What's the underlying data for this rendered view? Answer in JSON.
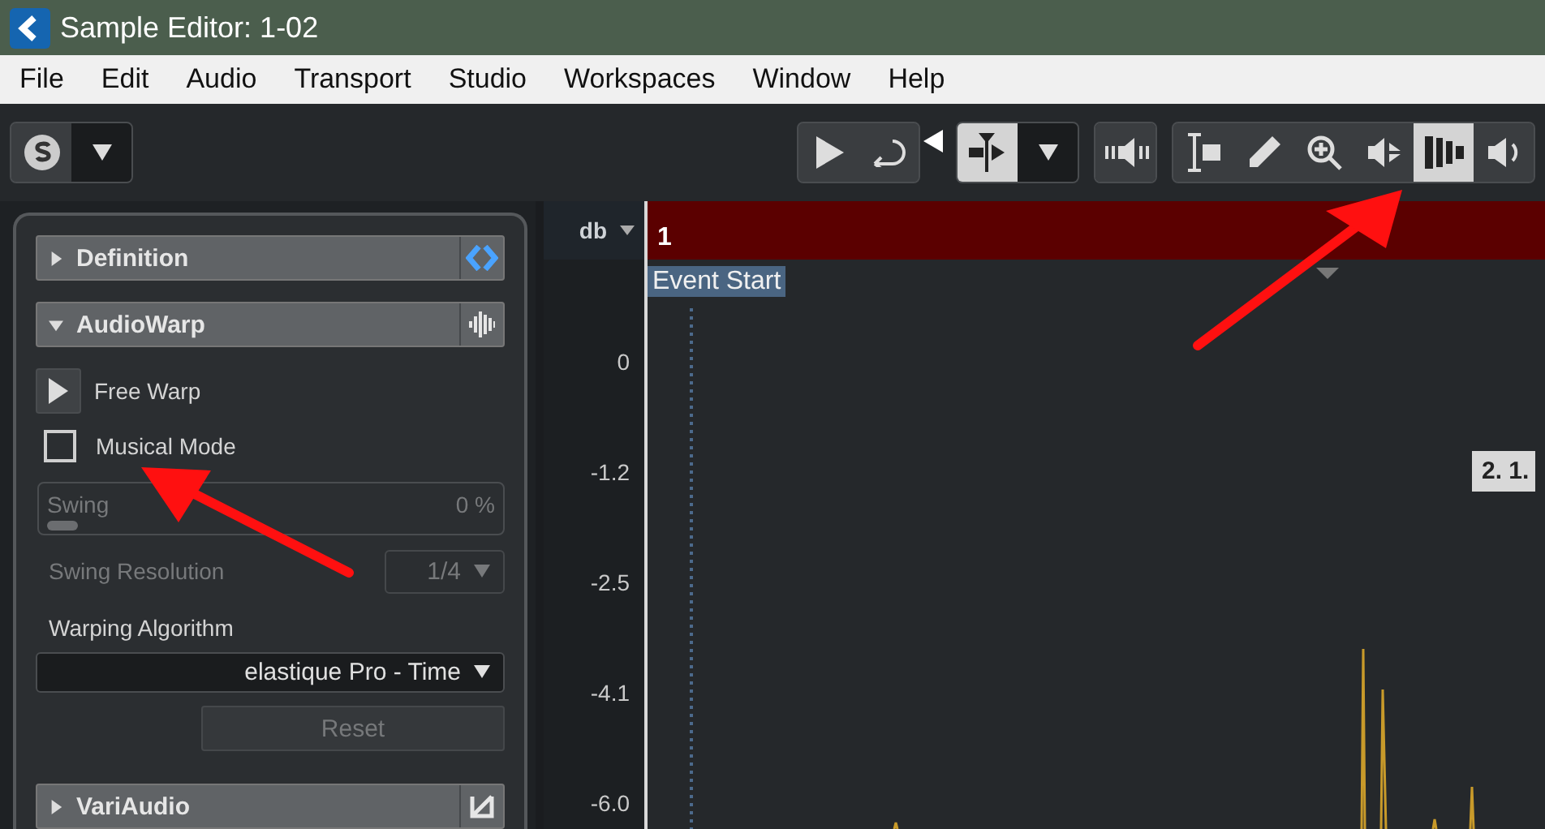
{
  "window": {
    "title": "Sample Editor: 1-02"
  },
  "menu": [
    "File",
    "Edit",
    "Audio",
    "Transport",
    "Studio",
    "Workspaces",
    "Window",
    "Help"
  ],
  "toolbar": {
    "groups": [
      {
        "tools": [
          {
            "kind": "solo-logo",
            "selected": false
          },
          {
            "kind": "dropdown",
            "selected": false
          }
        ]
      },
      {
        "tools": [
          {
            "kind": "play",
            "selected": false
          },
          {
            "kind": "loop",
            "selected": false
          }
        ]
      },
      {
        "tools": [
          {
            "kind": "split",
            "selected": true
          },
          {
            "kind": "dropdown",
            "selected": false
          }
        ]
      },
      {
        "tools": [
          {
            "kind": "audition",
            "selected": false
          }
        ]
      },
      {
        "tools": [
          {
            "kind": "range",
            "selected": false
          },
          {
            "kind": "pencil",
            "selected": false
          },
          {
            "kind": "zoom",
            "selected": false
          },
          {
            "kind": "mute",
            "selected": false
          },
          {
            "kind": "warp",
            "selected": true
          },
          {
            "kind": "speaker",
            "selected": false
          }
        ]
      }
    ]
  },
  "inspector": {
    "sections": [
      {
        "title": "Definition",
        "expanded": false,
        "kind": "definition"
      },
      {
        "title": "AudioWarp",
        "expanded": true,
        "kind": "audiowarp"
      }
    ],
    "free_warp": {
      "label": "Free Warp"
    },
    "musical_mode": {
      "label": "Musical Mode",
      "checked": false
    },
    "swing": {
      "label": "Swing",
      "value": "0 %",
      "level": 0,
      "disabled": true
    },
    "swing_resolution": {
      "label": "Swing Resolution",
      "value": "1/4",
      "disabled": true
    },
    "warping_algorithm": {
      "label": "Warping Algorithm",
      "value": "elastique Pro - Time"
    },
    "reset": {
      "label": "Reset",
      "disabled": true
    },
    "bottom_section": {
      "title": "VariAudio",
      "expanded": false,
      "kind": "variaudio"
    }
  },
  "editor": {
    "unit": "db",
    "ruler_start": "1",
    "event_label": "Event Start",
    "marker": "2. 1.",
    "scale": [
      "0",
      "-1.2",
      "-2.5",
      "-4.1",
      "-6.0"
    ]
  }
}
